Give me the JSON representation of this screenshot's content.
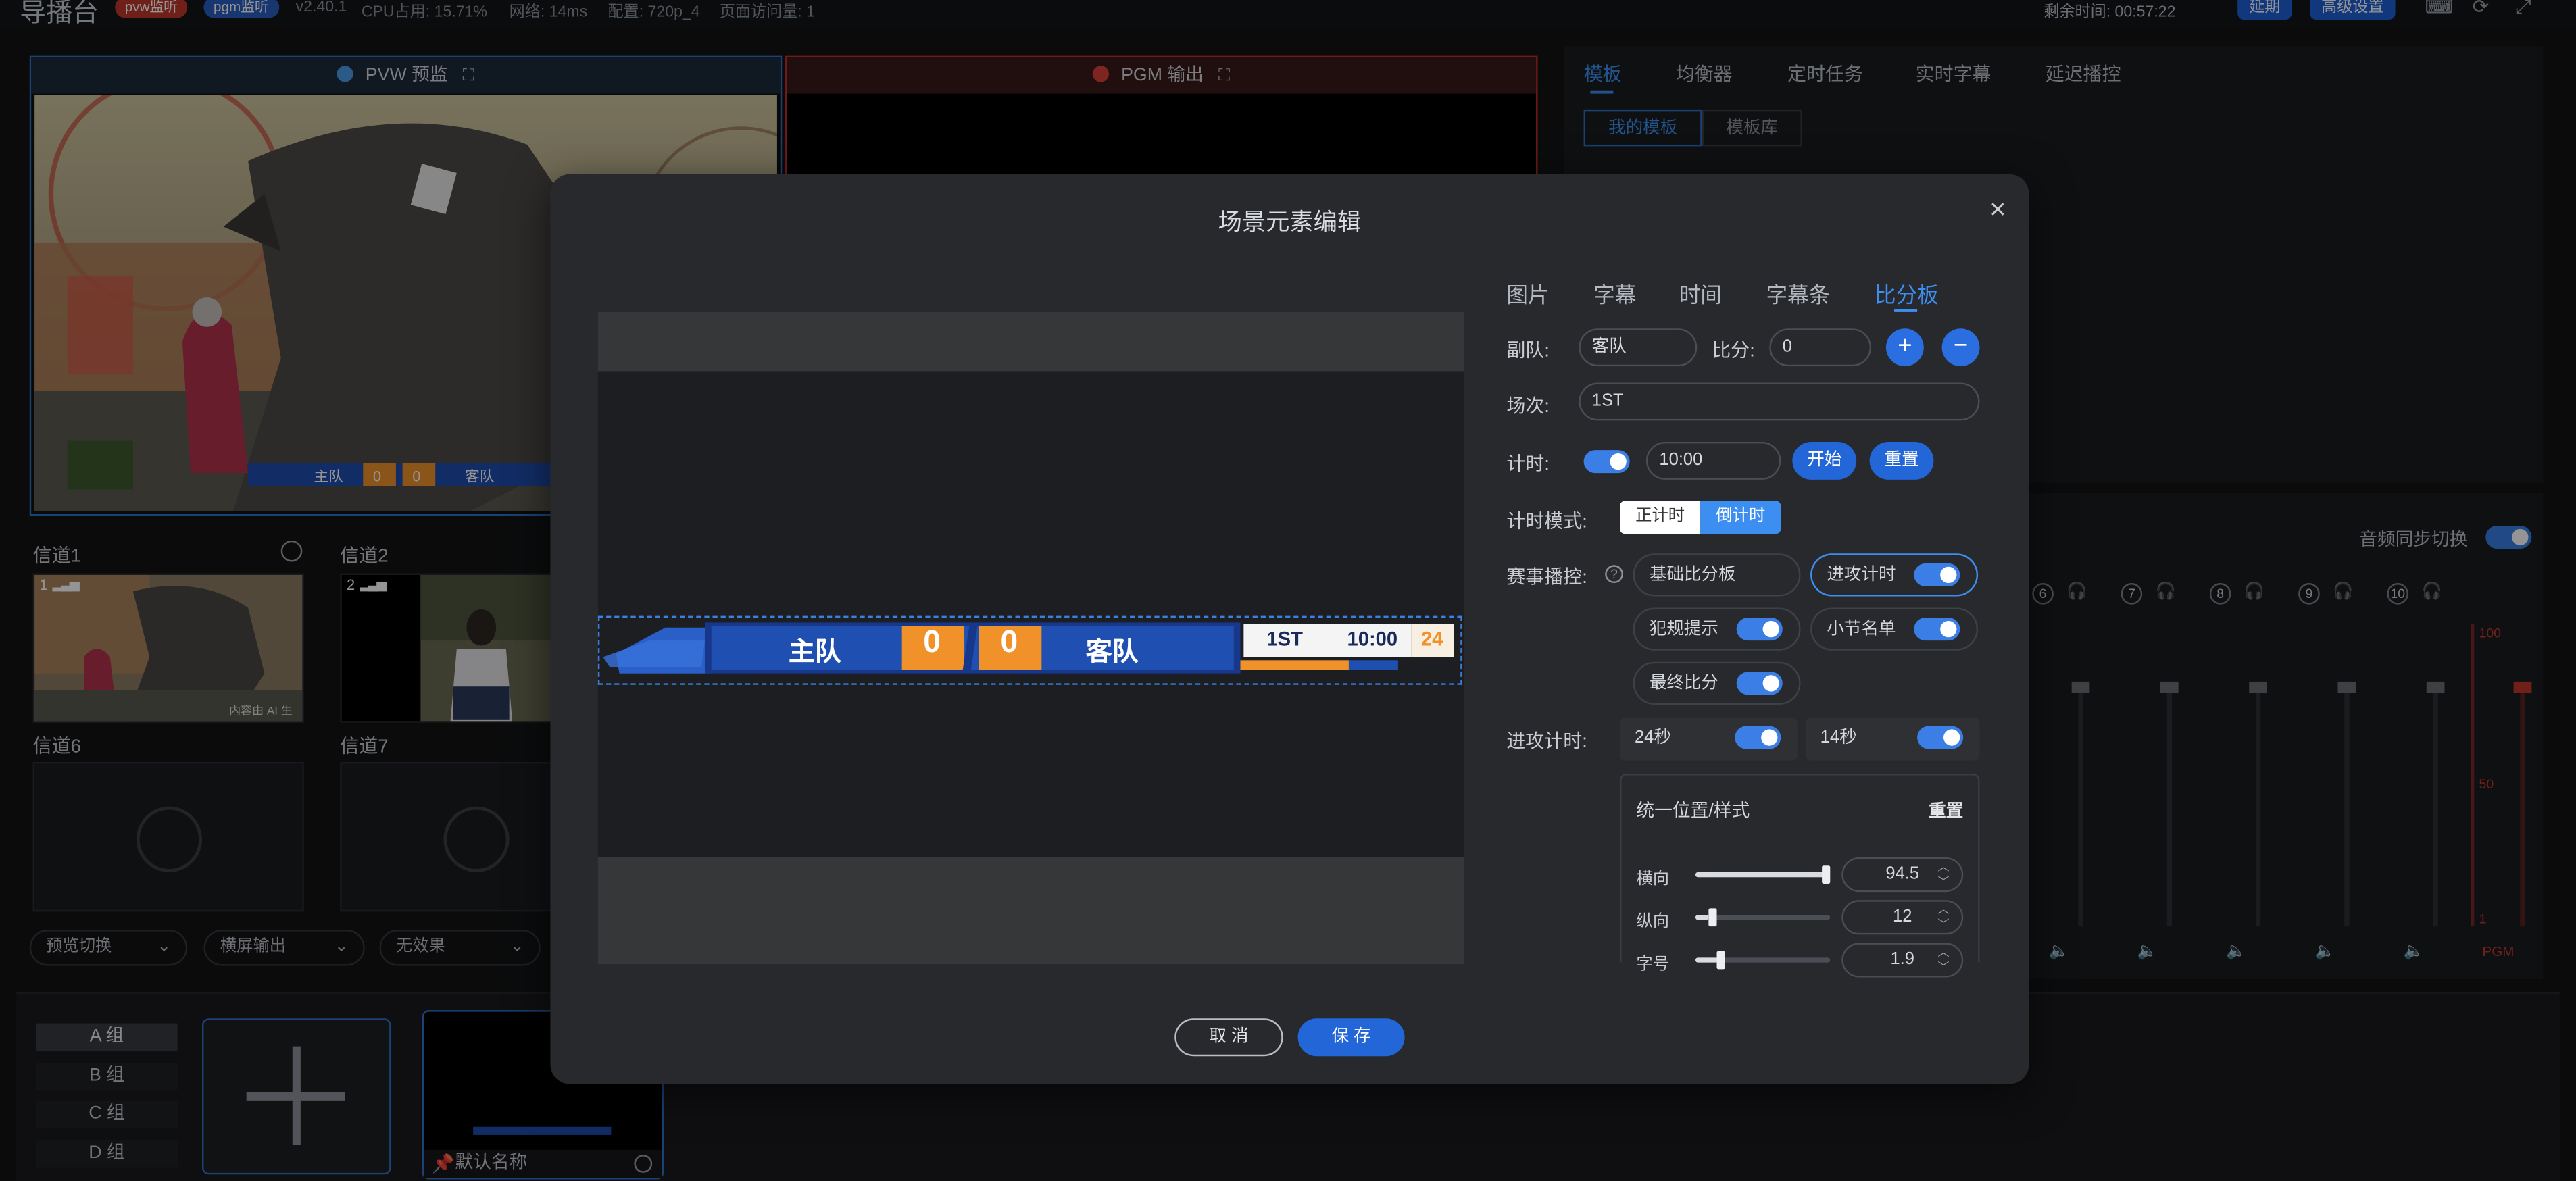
{
  "topbar": {
    "title": "导播台",
    "pvw_monitor": "pvw监听",
    "pgm_monitor": "pgm监听",
    "version": "v2.40.1",
    "cpu": "CPU占用: 15.71%",
    "network": "网络: 14ms",
    "config": "配置: 720p_4",
    "visits": "页面访问量: 1",
    "remaining": "剩余时间: 00:57:22",
    "extend_label": "延期",
    "advanced_label": "高级设置",
    "icons": [
      "keyboard-icon",
      "refresh-icon",
      "fullscreen-icon"
    ]
  },
  "pvw": {
    "label": "PVW 预监",
    "border": "#2d73c9"
  },
  "pgm": {
    "label": "PGM 输出",
    "border": "#c9302c"
  },
  "channels": {
    "ch1": "信道1",
    "ch2": "信道2",
    "ch6": "信道6",
    "ch7": "信道7",
    "ch1_num": "1",
    "ch2_num": "2",
    "ch1_watermark": "内容由 AI 生"
  },
  "dropdowns": {
    "preview_switch": "预览切换",
    "output_mode": "横屏输出",
    "effect": "无效果"
  },
  "groups": {
    "a": "A 组",
    "b": "B 组",
    "c": "C 组",
    "d": "D 组"
  },
  "scene_card": {
    "name": "默认名称"
  },
  "right_panel": {
    "tabs": [
      "模板",
      "均衡器",
      "定时任务",
      "实时字幕",
      "延迟播控"
    ],
    "active_tab": "模板",
    "subtabs": [
      "我的模板",
      "模板库"
    ],
    "audio_sync": "音频同步切换",
    "mixer_channels": [
      "6",
      "7",
      "8",
      "9",
      "10"
    ],
    "fader_label": "PGM",
    "scale": {
      "top": "100",
      "mid": "50",
      "bottom": "1"
    }
  },
  "modal": {
    "title": "场景元素编辑",
    "tabs": [
      "图片",
      "字幕",
      "时间",
      "字幕条",
      "比分板"
    ],
    "active_tab": "比分板",
    "away_label": "副队:",
    "away_value": "客队",
    "score_label": "比分:",
    "score_value": "0",
    "plus": "+",
    "minus": "−",
    "period_label": "场次:",
    "period_value": "1ST",
    "timer_label": "计时:",
    "timer_value": "10:00",
    "start_label": "开始",
    "reset_label": "重置",
    "mode_label": "计时模式:",
    "mode_options": [
      "正计时",
      "倒计时"
    ],
    "mode_active": "倒计时",
    "event_label": "赛事播控:",
    "event_chips": {
      "basic": "基础比分板",
      "attack": "进攻计时",
      "foul": "犯规提示",
      "roster": "小节名单",
      "final": "最终比分"
    },
    "attack_label": "进攻计时:",
    "attack_opts": [
      "24秒",
      "14秒"
    ],
    "position_title": "统一位置/样式",
    "position_reset": "重置",
    "sliders": [
      {
        "label": "横向",
        "value": "94.5",
        "fraction": 0.97
      },
      {
        "label": "纵向",
        "value": "12",
        "fraction": 0.1
      },
      {
        "label": "字号",
        "value": "1.9",
        "fraction": 0.17
      }
    ],
    "cancel_label": "取 消",
    "save_label": "保 存"
  },
  "scoreboard": {
    "home": "主队",
    "away": "客队",
    "home_score": "0",
    "away_score": "0",
    "period": "1ST",
    "clock": "10:00",
    "shot_clock": "24",
    "colors": {
      "primary": "#1f4fb0",
      "score": "#f0912a",
      "panel": "#f4f4f4"
    }
  },
  "colors": {
    "accent": "#2a6ee0",
    "background": "#131416",
    "modal": "#28292d"
  }
}
